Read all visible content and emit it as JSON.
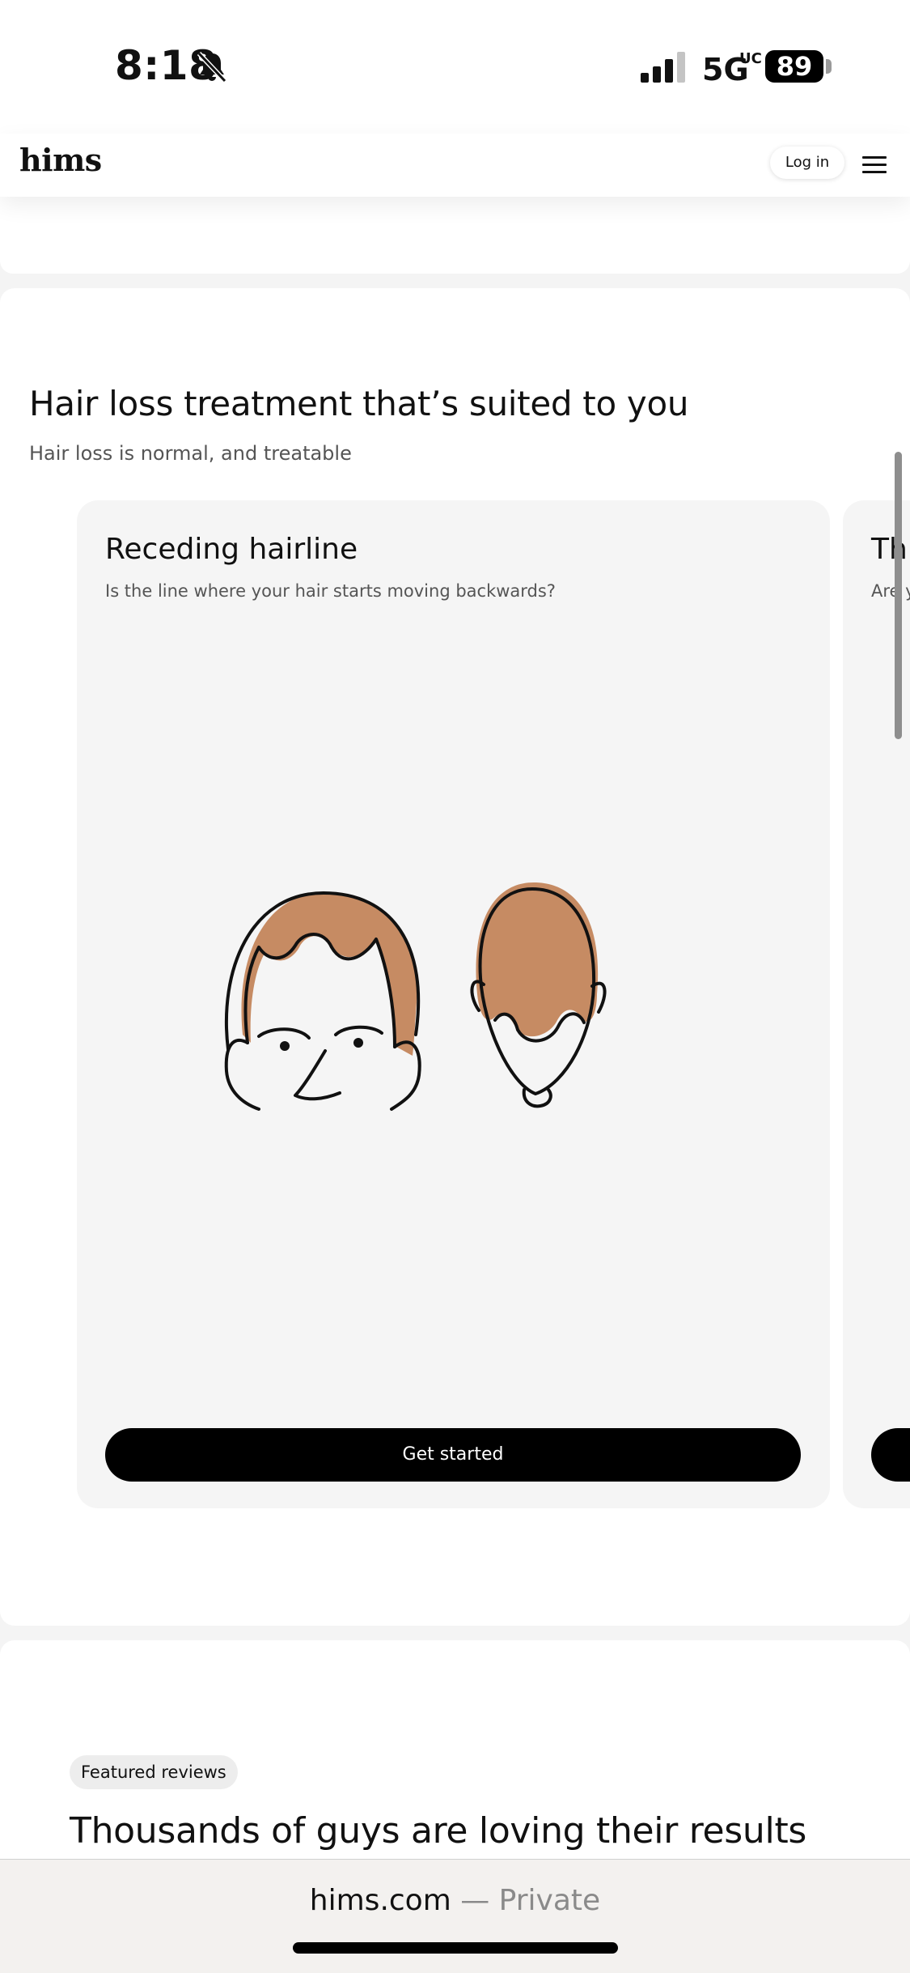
{
  "status_bar": {
    "time": "8:18",
    "network": "5G",
    "network_sub": "UC",
    "battery": "89"
  },
  "header": {
    "logo": "hims",
    "login_label": "Log in"
  },
  "section": {
    "title": "Hair loss treatment that’s suited to you",
    "subtitle": "Hair loss is normal, and treatable"
  },
  "cards": [
    {
      "title": "Receding hairline",
      "description": "Is the line where your hair starts moving backwards?",
      "cta": "Get started"
    },
    {
      "title": "Thi",
      "description": "Are y"
    }
  ],
  "reviews": {
    "badge": "Featured reviews",
    "title": "Thousands of guys are loving their results"
  },
  "browser": {
    "domain": "hims.com",
    "separator": " — ",
    "mode": "Private"
  },
  "colors": {
    "hair": "#C68B63",
    "button": "#000000",
    "card_bg": "#F5F5F5"
  }
}
